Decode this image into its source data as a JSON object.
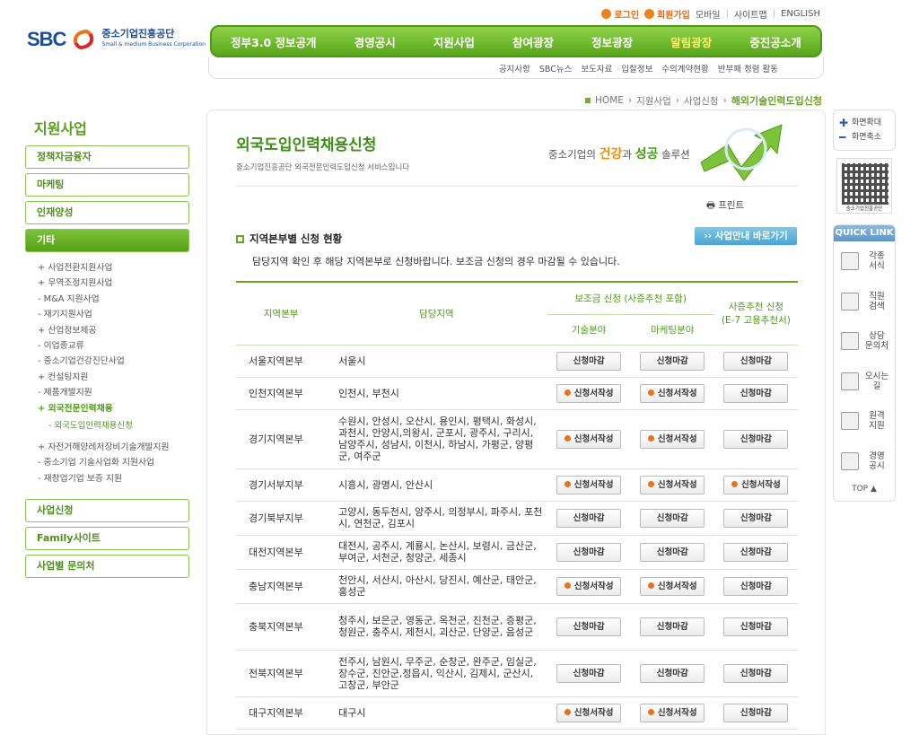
{
  "util": {
    "login": "로그인",
    "join": "회원가입",
    "mobile": "모바일",
    "sitemap": "사이트맵",
    "english": "ENGLISH"
  },
  "logo": {
    "brand": "SBC",
    "name": "중소기업진흥공단",
    "sub": "Small & medium Business Corporation"
  },
  "gnb": [
    {
      "label": "정부3.0 정보공개"
    },
    {
      "label": "경영공시"
    },
    {
      "label": "지원사업"
    },
    {
      "label": "참여광장"
    },
    {
      "label": "정보광장"
    },
    {
      "label": "알림광장"
    },
    {
      "label": "중진공소개"
    }
  ],
  "subnav": [
    "공지사항",
    "SBC뉴스",
    "보도자료",
    "입찰정보",
    "수의계약현황",
    "반부패 청렴 활동"
  ],
  "breadcrumb": {
    "home": "HOME",
    "b1": "지원사업",
    "b2": "사업신청",
    "current": "해외기술인력도입신청"
  },
  "lnb": {
    "title": "지원사업",
    "groups": [
      "정책자금융자",
      "마케팅",
      "인재양성",
      "기타"
    ],
    "items": [
      "+ 사업전환지원사업",
      "+ 무역조정지원사업",
      "- M&A 지원사업",
      "- 재기지원사업",
      "+ 산업정보제공",
      "- 이업종교류",
      "- 중소기업건강진단사업",
      "+ 컨설팅지원",
      "- 제품개발지원",
      "+ 외국전문인력채용"
    ],
    "sub_item": "- 외국도입인력채용신청",
    "items2": [
      "+ 자전거해양레저장비기술개발지원",
      "- 중소기업 기술사업화 지원사업",
      "- 재창업기업 보증 지원"
    ],
    "bottom": [
      "사업신청",
      "Family사이트",
      "사업별 문의처"
    ]
  },
  "content": {
    "title": "외국도입인력채용신청",
    "desc": "중소기업진흥공단 외국전문인력도입신청 서비스입니다",
    "slogan_pre": "중소기업의 ",
    "slogan_a": "건강",
    "slogan_mid": "과 ",
    "slogan_b": "성공",
    "slogan_post": " 솔루션",
    "print": "프린트",
    "section_title": "지역본부별 신청 현황",
    "go_button": "›› 사업안내 바로가기",
    "note": "담당지역 확인 후 해당 지역본부로 신청바랍니다. 보조금 신청의 경우 마감될 수 있습니다."
  },
  "table": {
    "h_region": "지역본부",
    "h_area": "담당지역",
    "h_subsidy": "보조금 신청 (사증추천 포함)",
    "h_tech": "기술분야",
    "h_mkt": "마케팅분야",
    "h_visa": "사증추천 신청",
    "h_visa2": "(E-7 고용추천서)",
    "rows": [
      {
        "region": "서울지역본부",
        "area": "서울시",
        "tech": "신청마감",
        "mkt": "신청마감",
        "visa": "신청마감",
        "t_open": false,
        "m_open": false,
        "v_open": false
      },
      {
        "region": "인천지역본부",
        "area": "인천시, 부천시",
        "tech": "신청서작성",
        "mkt": "신청서작성",
        "visa": "신청마감",
        "t_open": true,
        "m_open": true,
        "v_open": false
      },
      {
        "region": "경기지역본부",
        "area": "수원시, 안성시, 오산시, 용인시, 평택시, 화성시, 과천시, 안양시,의왕시, 군포시, 광주시, 구리시, 남양주시, 성남시, 이천시, 하남시, 가평군, 양평군, 여주군",
        "tech": "신청서작성",
        "mkt": "신청서작성",
        "visa": "신청마감",
        "t_open": true,
        "m_open": true,
        "v_open": false
      },
      {
        "region": "경기서부지부",
        "area": "시흥시, 광명시, 안산시",
        "tech": "신청서작성",
        "mkt": "신청서작성",
        "visa": "신청서작성",
        "t_open": true,
        "m_open": true,
        "v_open": true
      },
      {
        "region": "경기북부지부",
        "area": "고양시, 동두천시, 양주시, 의정부시, 파주시, 포천시, 연천군, 김포시",
        "tech": "신청마감",
        "mkt": "신청마감",
        "visa": "신청마감",
        "t_open": false,
        "m_open": false,
        "v_open": false
      },
      {
        "region": "대전지역본부",
        "area": "대전시, 공주시, 계룡시, 논산시, 보령시, 금산군, 부여군, 서천군, 청양군, 세종시",
        "tech": "신청마감",
        "mkt": "신청마감",
        "visa": "신청마감",
        "t_open": false,
        "m_open": false,
        "v_open": false
      },
      {
        "region": "충남지역본부",
        "area": "천안시, 서산시, 아산시, 당진시, 예산군, 태안군, 홍성군",
        "tech": "신청서작성",
        "mkt": "신청서작성",
        "visa": "신청마감",
        "t_open": true,
        "m_open": true,
        "v_open": false
      },
      {
        "region": "충북지역본부",
        "area": "청주시, 보은군, 영동군, 옥천군, 진천군, 증평군, 청원군, 충주시, 제천시, 괴산군, 단양군, 음성군",
        "tech": "신청마감",
        "mkt": "신청마감",
        "visa": "신청마감",
        "t_open": false,
        "m_open": false,
        "v_open": false
      },
      {
        "region": "전북지역본부",
        "area": "전주시, 남원시, 무주군, 순창군, 완주군, 임실군, 장수군, 진안군,정읍시, 익산시, 김제시, 군산시, 고창군, 부안군",
        "tech": "신청마감",
        "mkt": "신청마감",
        "visa": "신청마감",
        "t_open": false,
        "m_open": false,
        "v_open": false
      },
      {
        "region": "대구지역본부",
        "area": "대구시",
        "tech": "신청서작성",
        "mkt": "신청서작성",
        "visa": "신청마감",
        "t_open": true,
        "m_open": true,
        "v_open": false
      }
    ]
  },
  "right": {
    "zoom_in": "화면확대",
    "zoom_out": "화면축소",
    "qr_caption": "중소기업진흥공단",
    "quick_title": "QUICK LINK",
    "links": [
      "각종 서식",
      "직원 검색",
      "상담 문의처",
      "오시는 길",
      "원격 지원",
      "경영 공시"
    ],
    "top": "TOP ▲"
  },
  "colors": {
    "green": "#6aa224",
    "orange": "#e8731f",
    "blue": "#1a4b9c"
  }
}
